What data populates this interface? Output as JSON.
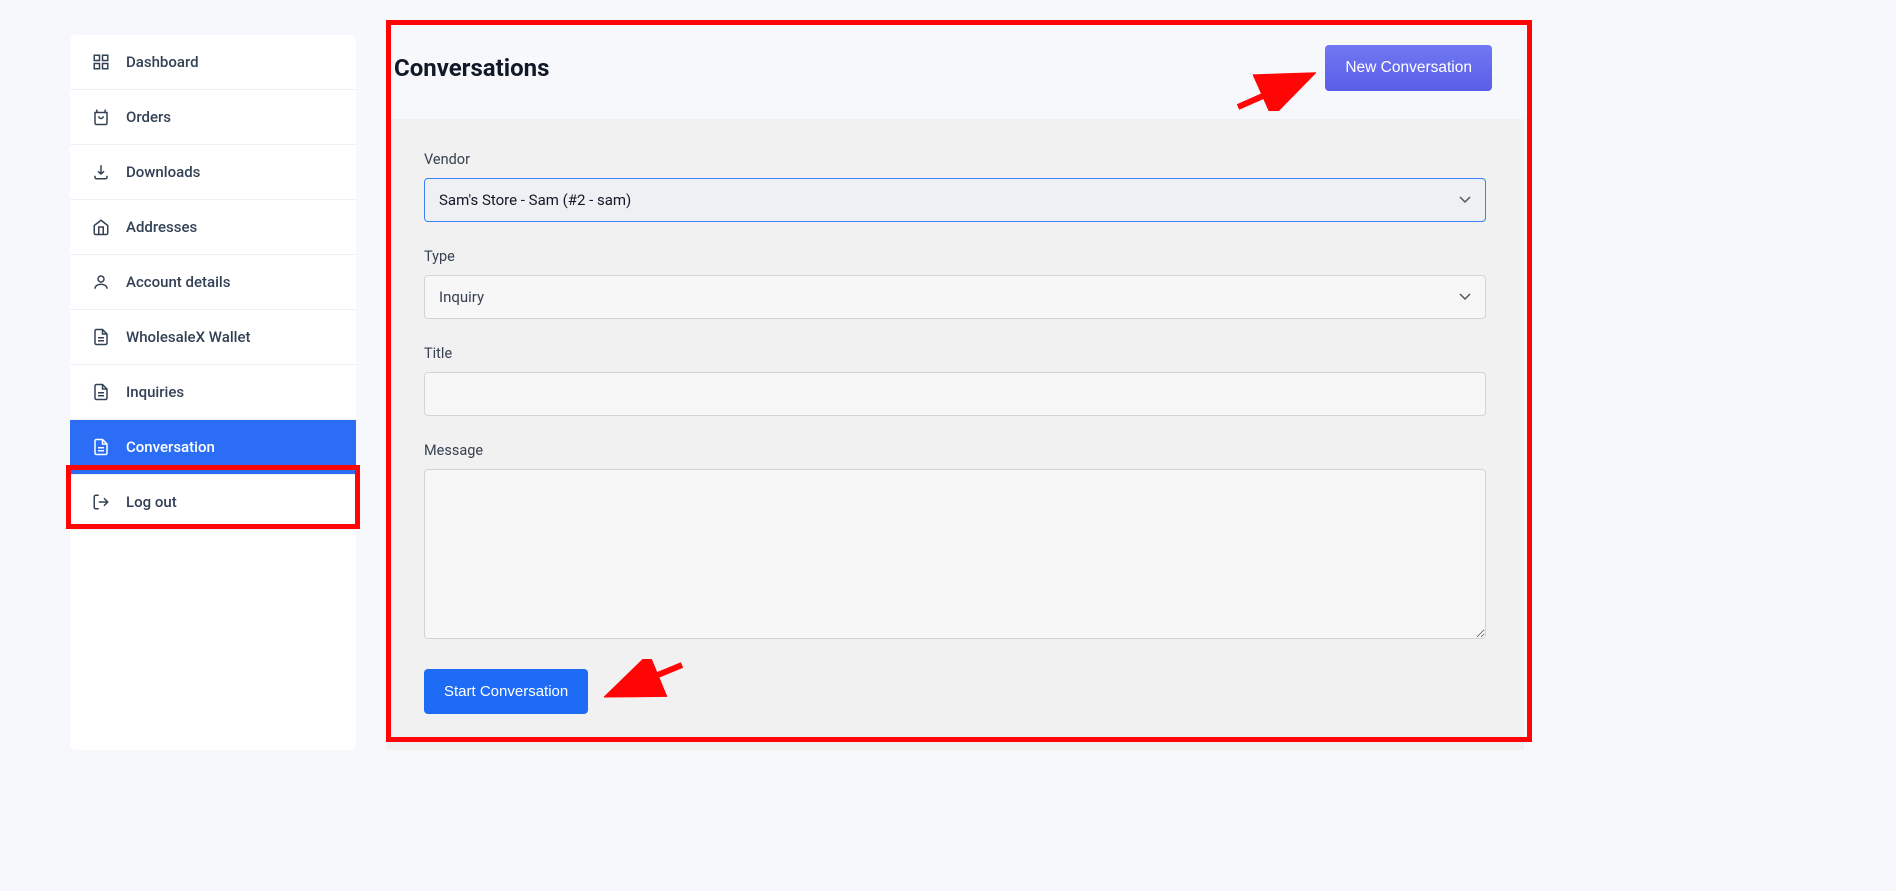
{
  "sidebar": {
    "items": [
      {
        "label": "Dashboard",
        "icon": "grid"
      },
      {
        "label": "Orders",
        "icon": "bag"
      },
      {
        "label": "Downloads",
        "icon": "download"
      },
      {
        "label": "Addresses",
        "icon": "home"
      },
      {
        "label": "Account details",
        "icon": "user"
      },
      {
        "label": "WholesaleX Wallet",
        "icon": "file"
      },
      {
        "label": "Inquiries",
        "icon": "file"
      },
      {
        "label": "Conversation",
        "icon": "file",
        "active": true
      },
      {
        "label": "Log out",
        "icon": "logout"
      }
    ]
  },
  "header": {
    "title": "Conversations",
    "new_button": "New Conversation"
  },
  "form": {
    "vendor_label": "Vendor",
    "vendor_value": "Sam's Store - Sam (#2 - sam)",
    "type_label": "Type",
    "type_value": "Inquiry",
    "title_label": "Title",
    "title_value": "",
    "message_label": "Message",
    "message_value": "",
    "start_button": "Start Conversation"
  }
}
